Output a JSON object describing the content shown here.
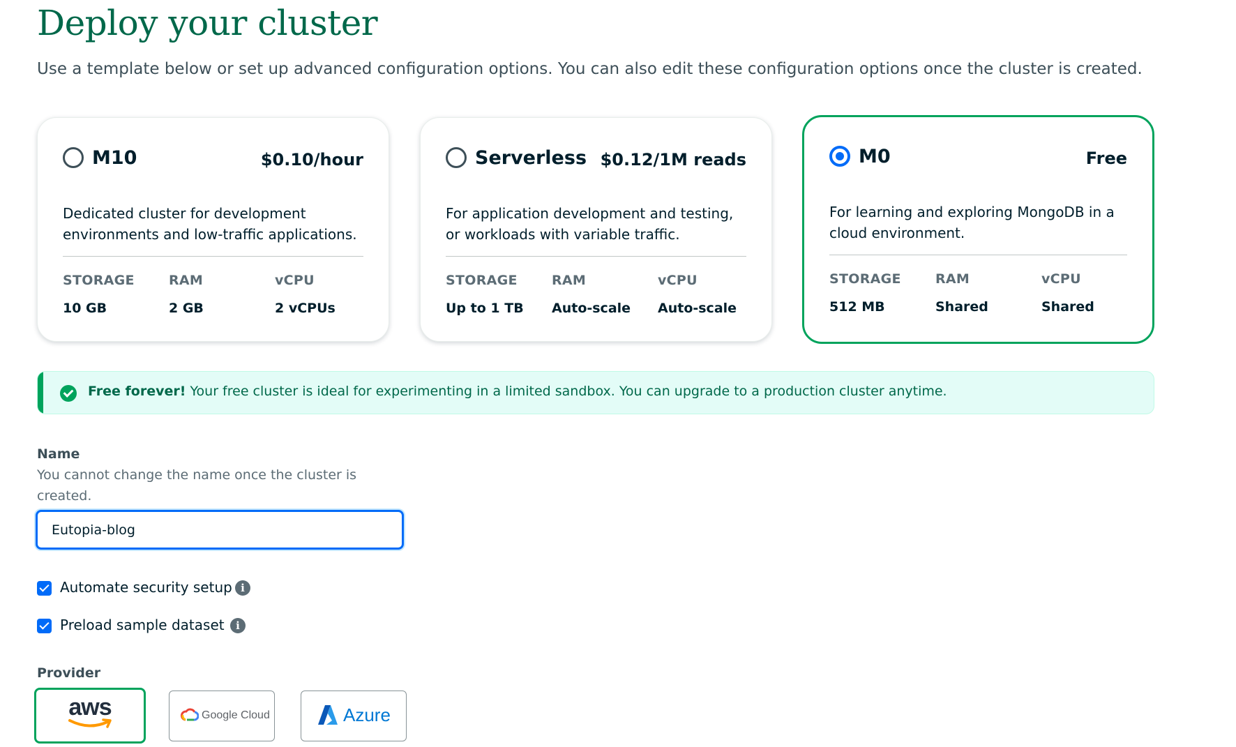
{
  "page": {
    "title": "Deploy your cluster",
    "subtitle": "Use a template below or set up advanced configuration options. You can also edit these configuration options once the cluster is created."
  },
  "tiers": [
    {
      "name": "M10",
      "price": "$0.10/hour",
      "selected": false,
      "description": "Dedicated cluster for development environments and low-traffic applications.",
      "specs": [
        {
          "label": "STORAGE",
          "value": "10 GB"
        },
        {
          "label": "RAM",
          "value": "2 GB"
        },
        {
          "label": "vCPU",
          "value": "2 vCPUs"
        }
      ]
    },
    {
      "name": "Serverless",
      "price": "$0.12/1M reads",
      "selected": false,
      "description": "For application development and testing, or workloads with variable traffic.",
      "specs": [
        {
          "label": "STORAGE",
          "value": "Up to 1 TB"
        },
        {
          "label": "RAM",
          "value": "Auto-scale"
        },
        {
          "label": "vCPU",
          "value": "Auto-scale"
        }
      ]
    },
    {
      "name": "M0",
      "price": "Free",
      "selected": true,
      "description": "For learning and exploring MongoDB in a cloud environment.",
      "specs": [
        {
          "label": "STORAGE",
          "value": "512 MB"
        },
        {
          "label": "RAM",
          "value": "Shared"
        },
        {
          "label": "vCPU",
          "value": "Shared"
        }
      ]
    }
  ],
  "banner": {
    "strong": "Free forever!",
    "text": " Your free cluster is ideal for experimenting in a limited sandbox. You can upgrade to a production cluster anytime."
  },
  "name_field": {
    "label": "Name",
    "help": "You cannot change the name once the cluster is created.",
    "value": "Eutopia-blog"
  },
  "options": [
    {
      "label": "Automate security setup",
      "checked": true
    },
    {
      "label": "Preload sample dataset",
      "checked": true
    }
  ],
  "provider": {
    "label": "Provider",
    "items": [
      {
        "name": "aws",
        "selected": true
      },
      {
        "name": "Google Cloud",
        "selected": false
      },
      {
        "name": "Azure",
        "selected": false
      }
    ]
  },
  "colors": {
    "brand_green": "#00684a",
    "accent_green": "#00a35c",
    "accent_blue": "#016bf8"
  }
}
